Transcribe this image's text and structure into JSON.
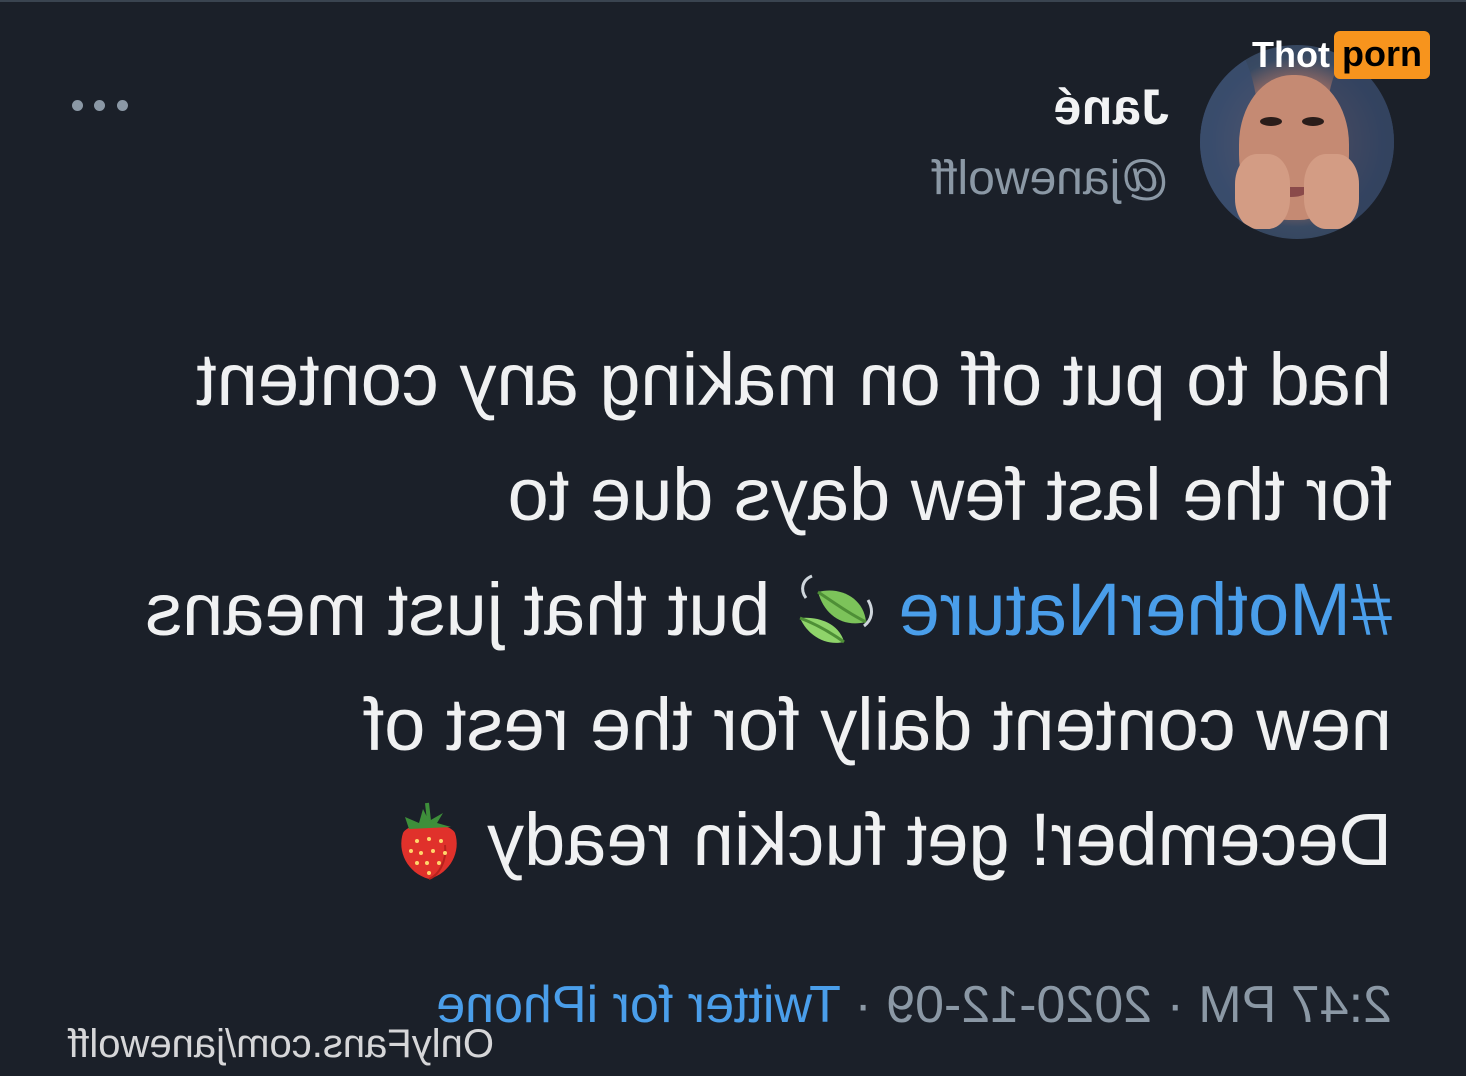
{
  "tweet_card": {
    "author_name": "Jané",
    "author_handle": "@janewolff",
    "lines": [
      [
        "had to put off on making any content"
      ],
      [
        "for the last few days due to"
      ],
      [
        "#MotherNature",
        "but that just means"
      ],
      [
        "new content daily for the rest of"
      ],
      [
        "December! get fuckin ready"
      ]
    ],
    "emojis": [
      "leaf-emoji",
      "strawberry-emoji"
    ],
    "timestamp": "2:47 PM · 2020-12-09 · ",
    "source": "Twitter for iPhone"
  },
  "watermarks": {
    "onlyfans_url": "OnlyFans.com/janewolff",
    "logo_white": "Thot",
    "logo_orange": "porn"
  },
  "colors": {
    "background": "#1b2029",
    "link": "#4a9eea",
    "muted": "#8b98a5",
    "logo_accent": "#f7941d"
  }
}
